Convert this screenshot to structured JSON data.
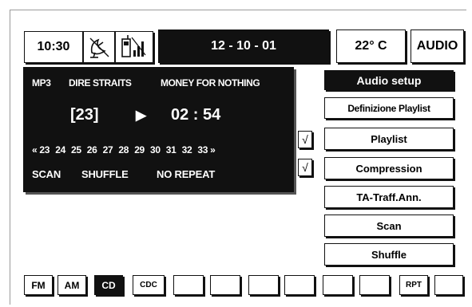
{
  "header": {
    "time": "10:30",
    "date": "12 - 10 - 01",
    "temperature": "22° C",
    "mode_button": "AUDIO",
    "icons": [
      "satellite-dish-crossed-icon",
      "phone-icon"
    ]
  },
  "display": {
    "format": "MP3",
    "artist": "DIRE STRAITS",
    "title": "MONEY FOR NOTHING",
    "track": "[23]",
    "play_symbol": "▶",
    "elapsed": "02 : 54",
    "track_list": [
      "« 23",
      "24",
      "25",
      "26",
      "27",
      "28",
      "29",
      "30",
      "31",
      "32",
      "33 »"
    ],
    "scan": "SCAN",
    "shuffle": "SHUFFLE",
    "repeat": "NO REPEAT"
  },
  "checks": [
    "√",
    "√"
  ],
  "menu": {
    "header": "Audio setup",
    "items": [
      "Definizione Playlist",
      "Playlist",
      "Compression",
      "TA-Traff.Ann.",
      "Scan",
      "Shuffle"
    ]
  },
  "sources": [
    "FM",
    "AM",
    "CD",
    "CDC",
    "RPT"
  ],
  "colors": {
    "panel": "#111111",
    "background": "#ffffff"
  }
}
